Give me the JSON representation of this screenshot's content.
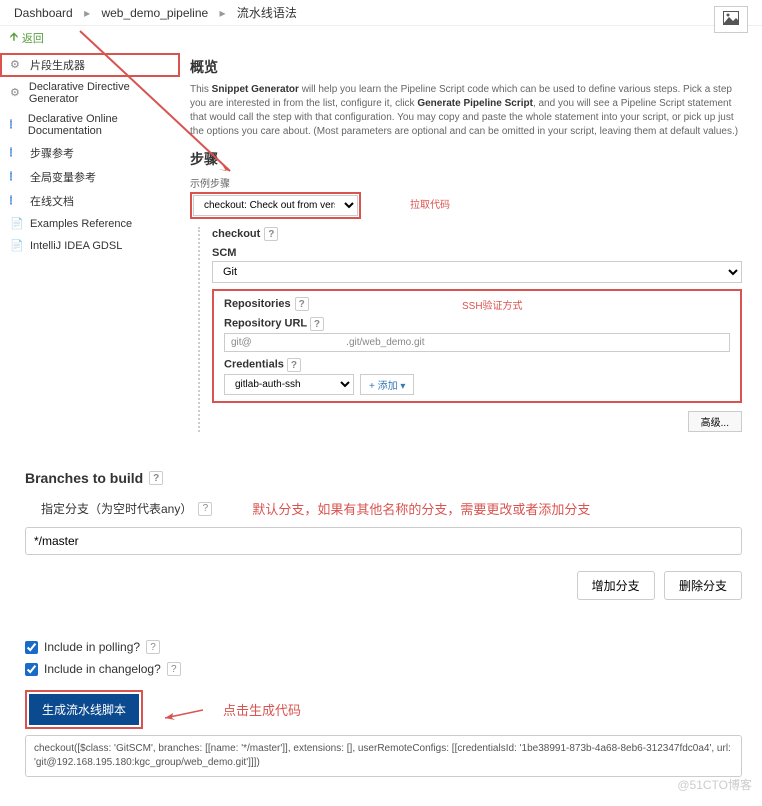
{
  "breadcrumb": {
    "items": [
      "Dashboard",
      "web_demo_pipeline",
      "流水线语法"
    ]
  },
  "back": "返回",
  "sidebar": {
    "items": [
      "片段生成器",
      "Declarative Directive Generator",
      "Declarative Online Documentation",
      "步骤参考",
      "全局变量参考",
      "在线文档",
      "Examples Reference",
      "IntelliJ IDEA GDSL"
    ]
  },
  "overview": {
    "title": "概览",
    "desc_prefix": "This ",
    "desc_bold1": "Snippet Generator",
    "desc_mid": " will help you learn the Pipeline Script code which can be used to define various steps. Pick a step you are interested in from the list, configure it, click ",
    "desc_bold2": "Generate Pipeline Script",
    "desc_suffix": ", and you will see a Pipeline Script statement that would call the step with that configuration. You may copy and paste the whole statement into your script, or pick up just the options you care about. (Most parameters are optional and can be omitted in your script, leaving them at default values.)"
  },
  "steps": {
    "title": "步骤",
    "sample_label": "示例步骤",
    "selected": "checkout: Check out from version control",
    "annotation_pull": "拉取代码",
    "checkout_label": "checkout",
    "scm_label": "SCM",
    "scm_value": "Git",
    "repo_title": "Repositories",
    "repo_url_label": "Repository URL",
    "repo_url_value": "git@                                  .git/web_demo.git",
    "cred_label": "Credentials",
    "cred_value": "gitlab-auth-ssh",
    "add_btn": "+ 添加 ▾",
    "annotation_ssh": "SSH验证方式",
    "advanced": "高级..."
  },
  "branches": {
    "title": "Branches to build",
    "sub": "指定分支（为空时代表any）",
    "value": "*/master",
    "annotation": "默认分支，如果有其他名称的分支，需要更改或者添加分支",
    "add_btn": "增加分支",
    "del_btn": "删除分支"
  },
  "options": {
    "polling": "Include in polling?",
    "changelog": "Include in changelog?"
  },
  "generate": {
    "btn": "生成流水线脚本",
    "annotation": "点击生成代码",
    "output": "checkout([$class: 'GitSCM', branches: [[name: '*/master']], extensions: [], userRemoteConfigs: [[credentialsId: '1be38991-873b-4a68-8eb6-312347fdc0a4', url: 'git@192.168.195.180:kgc_group/web_demo.git']]])"
  },
  "watermark": "@51CTO博客"
}
